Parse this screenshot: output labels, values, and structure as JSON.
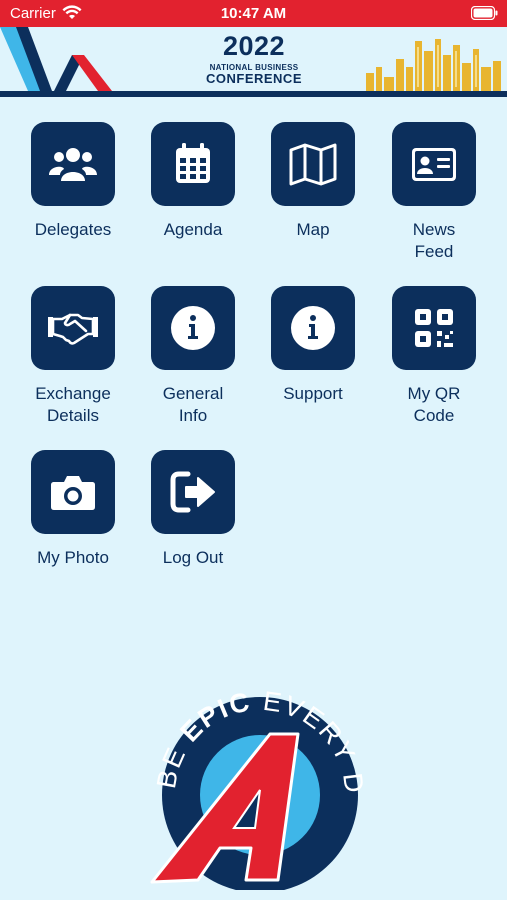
{
  "status_bar": {
    "carrier": "Carrier",
    "time": "10:47 AM"
  },
  "banner": {
    "year": "2022",
    "subtitle": "NATIONAL BUSINESS",
    "title": "CONFERENCE",
    "colors": {
      "navy": "#0c2f5c",
      "red": "#e2222f",
      "sky": "#3fb6e8",
      "gold": "#e8b530"
    }
  },
  "tiles": [
    {
      "label": "Delegates",
      "icon": "users-icon"
    },
    {
      "label": "Agenda",
      "icon": "calendar-icon"
    },
    {
      "label": "Map",
      "icon": "map-icon"
    },
    {
      "label": "News\nFeed",
      "icon": "id-card-icon"
    },
    {
      "label": "Exchange\nDetails",
      "icon": "handshake-icon"
    },
    {
      "label": "General\nInfo",
      "icon": "info-icon"
    },
    {
      "label": "Support",
      "icon": "info-icon"
    },
    {
      "label": "My QR\nCode",
      "icon": "qr-code-icon"
    },
    {
      "label": "My Photo",
      "icon": "camera-icon"
    },
    {
      "label": "Log Out",
      "icon": "logout-icon"
    }
  ],
  "footer_logo": {
    "text_be": "BE",
    "text_epic": "EPIC",
    "text_every_day": "EVERY DAY",
    "letter": "A"
  }
}
